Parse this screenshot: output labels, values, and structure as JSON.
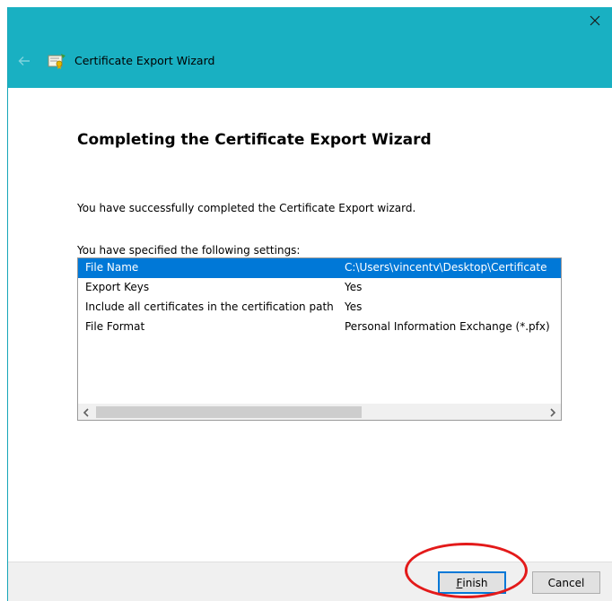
{
  "window": {
    "title": "Certificate Export Wizard"
  },
  "page": {
    "heading": "Completing the Certificate Export Wizard",
    "success_text": "You have successfully completed the Certificate Export wizard.",
    "settings_label": "You have specified the following settings:"
  },
  "settings": [
    {
      "name": "File Name",
      "value": "C:\\Users\\vincentv\\Desktop\\Certificate",
      "selected": true
    },
    {
      "name": "Export Keys",
      "value": "Yes",
      "selected": false
    },
    {
      "name": "Include all certificates in the certification path",
      "value": "Yes",
      "selected": false
    },
    {
      "name": "File Format",
      "value": "Personal Information Exchange (*.pfx)",
      "selected": false
    }
  ],
  "buttons": {
    "finish_mnemonic": "F",
    "finish_rest": "inish",
    "cancel": "Cancel"
  },
  "icons": {
    "close": "close-icon",
    "back": "back-arrow-icon",
    "wizard": "certificate-icon",
    "scroll_left": "chevron-left-icon",
    "scroll_right": "chevron-right-icon"
  },
  "colors": {
    "header": "#19b0c2",
    "selection": "#0078d7",
    "highlight": "#e31a1a"
  }
}
